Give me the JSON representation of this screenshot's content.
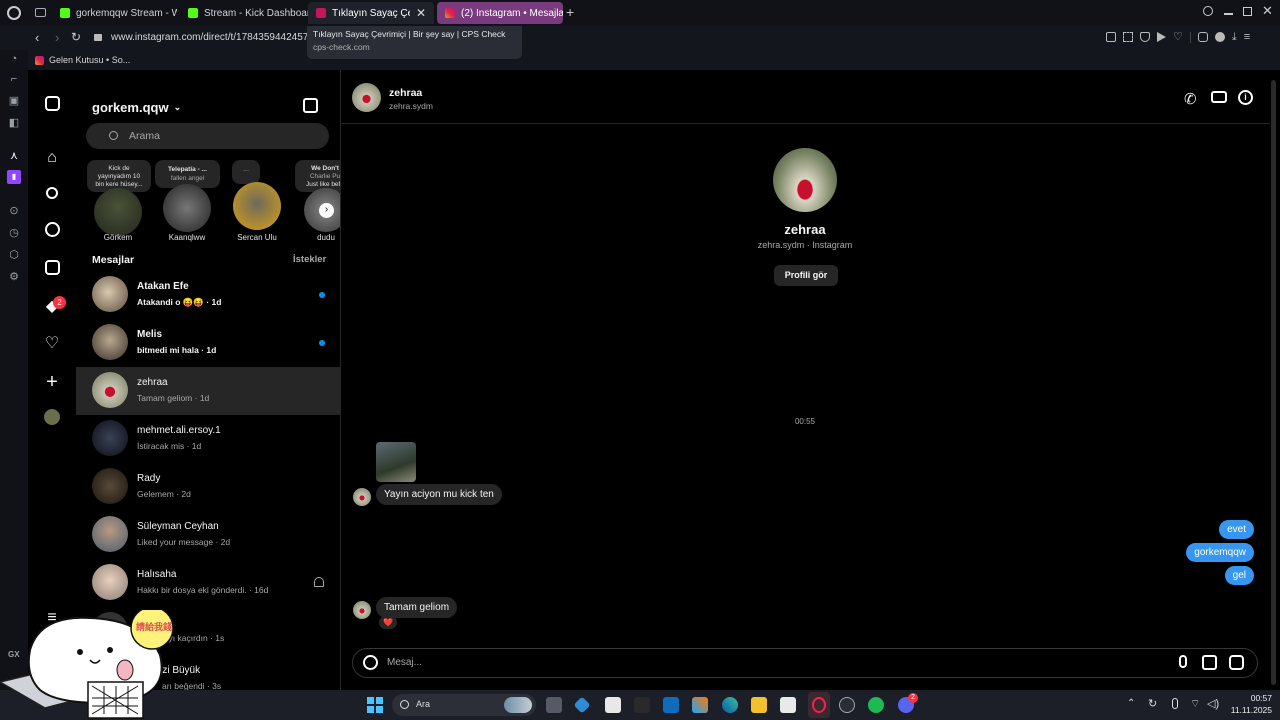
{
  "browser": {
    "tabs": [
      {
        "label": "gorkemqqw Stream - Wat"
      },
      {
        "label": "Stream - Kick Dashboard"
      },
      {
        "label": "Tıklayın Sayaç Çevri"
      },
      {
        "label": "(2) Instagram • Mesajlar"
      }
    ],
    "url": "www.instagram.com/direct/t/17843594424579",
    "tooltip": {
      "title": "Tıklayın Sayaç Çevrimiçi | Bir şey say | CPS Check",
      "domain": "cps-check.com"
    },
    "bookmark": "Gelen Kutusu • So...",
    "gx_badge": "2",
    "gx_label": "GX"
  },
  "inbox": {
    "username": "gorkem.qqw",
    "search_placeholder": "Arama",
    "notes": [
      {
        "name": "Görkem",
        "note_line1": "Kick de",
        "note_line2": "yayınyadım 10",
        "note_line3": "bin kere hüsey..."
      },
      {
        "name": "Kaanqlww",
        "note_line1": "Telepatía - ...",
        "note_line2": "fallen angel",
        "note_line3": ""
      },
      {
        "name": "Sercan Ulu",
        "note_line1": "...",
        "note_line2": "",
        "note_line3": ""
      },
      {
        "name": "dudu",
        "note_line1": "We Don't",
        "note_line2": "Charlie Pu",
        "note_line3": "Just like befo"
      }
    ],
    "messages_header": "Mesajlar",
    "requests_label": "İstekler",
    "conversations": [
      {
        "name": "Atakan Efe",
        "preview": "Atakandi o 😝😝 · 1d",
        "unread": true
      },
      {
        "name": "Melis",
        "preview": "bitmedi mi hala · 1d",
        "unread": true
      },
      {
        "name": "zehraa",
        "preview": "Tamam geliom · 1d",
        "unread": false
      },
      {
        "name": "mehmet.ali.ersoy.1",
        "preview": "İstiracak mis · 1d",
        "unread": false
      },
      {
        "name": "Rady",
        "preview": "Gelemem · 2d",
        "unread": false
      },
      {
        "name": "Süleyman Ceyhan",
        "preview": "Liked your message · 2d",
        "unread": false
      },
      {
        "name": "Halısaha",
        "preview": "Hakkı bir dosya eki gönderdi. · 16d",
        "unread": false
      },
      {
        "name": "MC",
        "preview": "amayı kaçırdın · 1s",
        "unread": false
      },
      {
        "name": "mzi Büyük",
        "preview": "arı beğendi · 3s",
        "unread": false
      }
    ],
    "notif_badge": "2"
  },
  "chat": {
    "header_name": "zehraa",
    "header_username": "zehra.sydm",
    "profile_name": "zehraa",
    "profile_sub": "zehra.sydm · Instagram",
    "view_profile_button": "Profili gör",
    "timestamp": "00:55",
    "incoming_1": "Yayın aciyon mu kick ten",
    "outgoing": [
      "evet",
      "gorkemqqw",
      "gel"
    ],
    "incoming_2": "Tamam geliom",
    "reaction": "❤️",
    "composer_placeholder": "Mesaj..."
  },
  "sticker": {
    "text": "請給我錢"
  },
  "taskbar": {
    "search_label": "Ara",
    "time": "00:57",
    "date": "11.11.2025",
    "discord_badge": "2"
  },
  "colors": {
    "accent": "#0095f6",
    "outgoing_bubble": "#3797f0",
    "instagram_tab": "#7a3a7e",
    "badge": "#ff3040"
  }
}
